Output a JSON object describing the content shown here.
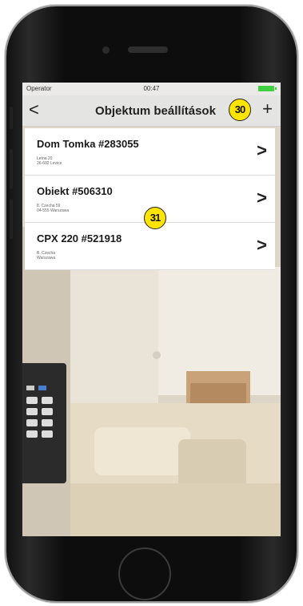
{
  "status": {
    "carrier": "Operator",
    "time": "00:47"
  },
  "nav": {
    "back": "<",
    "title": "Objektum beállítások",
    "add": "+"
  },
  "annotations": {
    "badge_top": "30",
    "badge_list": "31"
  },
  "objects": [
    {
      "title": "Dom Tomka #283055",
      "line1": "Letna 20",
      "line2": "26-602 Levice"
    },
    {
      "title": "Obiekt #506310",
      "line1": "8. Czecha 59",
      "line2": "04-555 Warszawa"
    },
    {
      "title": "CPX 220 #521918",
      "line1": "B. Czecha",
      "line2": "Warszawa"
    }
  ],
  "chevron": ">",
  "colors": {
    "badge": "#ffe400",
    "battery": "#3fd13f",
    "navbar": "#e4e4e4"
  }
}
